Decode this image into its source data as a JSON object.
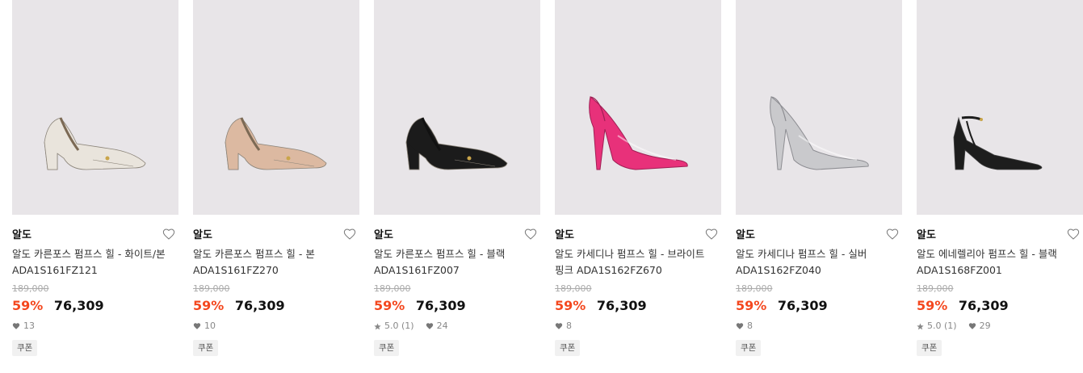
{
  "products": [
    {
      "brand": "알도",
      "name": "알도 카른포스 펌프스 힐 - 화이트/본 ADA1S161FZ121",
      "original_price": "189,000",
      "discount": "59%",
      "price": "76,309",
      "rating": "",
      "likes": "13",
      "badge": "쿠폰",
      "shoe_color": "#e9e4dc"
    },
    {
      "brand": "알도",
      "name": "알도 카른포스 펌프스 힐 - 본 ADA1S161FZ270",
      "original_price": "189,000",
      "discount": "59%",
      "price": "76,309",
      "rating": "",
      "likes": "10",
      "badge": "쿠폰",
      "shoe_color": "#dcb9a1"
    },
    {
      "brand": "알도",
      "name": "알도 카른포스 펌프스 힐 - 블랙 ADA1S161FZ007",
      "original_price": "189,000",
      "discount": "59%",
      "price": "76,309",
      "rating": "5.0 (1)",
      "likes": "24",
      "badge": "쿠폰",
      "shoe_color": "#1b1b1b"
    },
    {
      "brand": "알도",
      "name": "알도 카세디나 펌프스 힐 - 브라이트 핑크 ADA1S162FZ670",
      "original_price": "189,000",
      "discount": "59%",
      "price": "76,309",
      "rating": "",
      "likes": "8",
      "badge": "쿠폰",
      "shoe_color": "#e8317a"
    },
    {
      "brand": "알도",
      "name": "알도 카세디나 펌프스 힐 - 실버 ADA1S162FZ040",
      "original_price": "189,000",
      "discount": "59%",
      "price": "76,309",
      "rating": "",
      "likes": "8",
      "badge": "쿠폰",
      "shoe_color": "#c9c9cc"
    },
    {
      "brand": "알도",
      "name": "알도 에네렐리아 펌프스 힐 - 블랙 ADA1S168FZ001",
      "original_price": "189,000",
      "discount": "59%",
      "price": "76,309",
      "rating": "5.0 (1)",
      "likes": "29",
      "badge": "쿠폰",
      "shoe_color": "#1d1d1d"
    }
  ],
  "colors": {
    "discount": "#f4481f",
    "image_bg": "#e8e5e8"
  },
  "icons": {
    "wishlist": "heart-outline-icon",
    "likes": "heart-filled-icon",
    "rating": "star-icon"
  }
}
